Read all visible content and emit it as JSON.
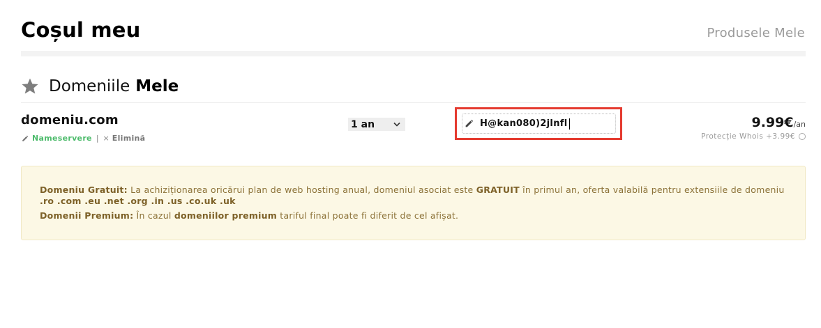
{
  "header": {
    "title": "Coșul meu",
    "link": "Produsele Mele"
  },
  "section": {
    "heading_prefix": "Domeniile",
    "heading_bold": "Mele",
    "icon": "star-icon"
  },
  "domain_row": {
    "name": "domeniu.com",
    "nameservers_label": "Nameservere",
    "separator": "|",
    "remove_icon": "×",
    "remove_label": "Elimină",
    "period_value": "1 an",
    "nameserver_input_value": "H@kan080)2jlnfl",
    "price_value": "9.99€",
    "price_unit": "/an",
    "whois_label": "Protecție Whois +3.99€"
  },
  "info": {
    "p1_label": "Domeniu Gratuit:",
    "p1_text_a": " La achiziționarea oricărui plan de web hosting anual, domeniul asociat este ",
    "p1_bold": "GRATUIT",
    "p1_text_b": " în primul an, oferta valabilă pentru extensiile de domeniu ",
    "p1_extensions": ".ro .com .eu .net .org .in .us .co.uk .uk",
    "p2_label": "Domenii Premium:",
    "p2_text_a": " În cazul ",
    "p2_bold": "domeniilor premium",
    "p2_text_b": " tariful final poate fi diferit de cel afișat."
  },
  "colors": {
    "accent_green": "#4cbb6b",
    "highlight_red": "#e53b30",
    "info_bg": "#fcf8e5",
    "info_text": "#8c7238"
  }
}
